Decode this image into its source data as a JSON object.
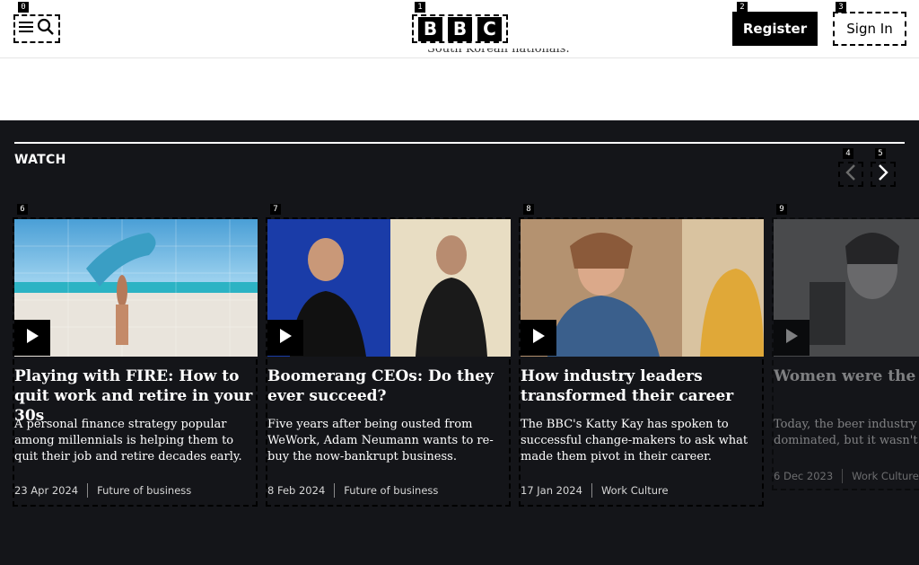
{
  "header": {
    "menu_label": "Menu",
    "logo_letters": [
      "B",
      "B",
      "C"
    ],
    "register_label": "Register",
    "signin_label": "Sign In"
  },
  "partial_text": "South Korean nationals.",
  "watch": {
    "title": "WATCH",
    "prev_icon": "chevron-left-icon",
    "next_icon": "chevron-right-icon"
  },
  "cards": [
    {
      "title": "Playing with FIRE: How to quit work and retire in your 30s",
      "description": "A personal finance strategy popular among millennials is helping them to quit their job and retire decades early.",
      "date": "23 Apr 2024",
      "category": "Future of business"
    },
    {
      "title": "Boomerang CEOs: Do they ever succeed?",
      "description": "Five years after being ousted from WeWork, Adam Neumann wants to re-buy the now-bankrupt business.",
      "date": "8 Feb 2024",
      "category": "Future of business"
    },
    {
      "title": "How industry leaders transformed their career",
      "description": "The BBC's Katty Kay has spoken to successful change-makers to ask what made them pivot in their career.",
      "date": "17 Jan 2024",
      "category": "Work Culture"
    },
    {
      "title": "Women were the brewers - what changed?",
      "description": "Today, the beer industry is male-dominated, but it wasn't always so.",
      "date": "6 Dec 2023",
      "category": "Work Culture"
    }
  ],
  "badges": [
    "0",
    "1",
    "2",
    "3",
    "4",
    "5",
    "6",
    "7",
    "8",
    "9"
  ],
  "colors": {
    "section_bg": "#141519",
    "text": "#ffffff",
    "meta": "#d6d6d6"
  }
}
